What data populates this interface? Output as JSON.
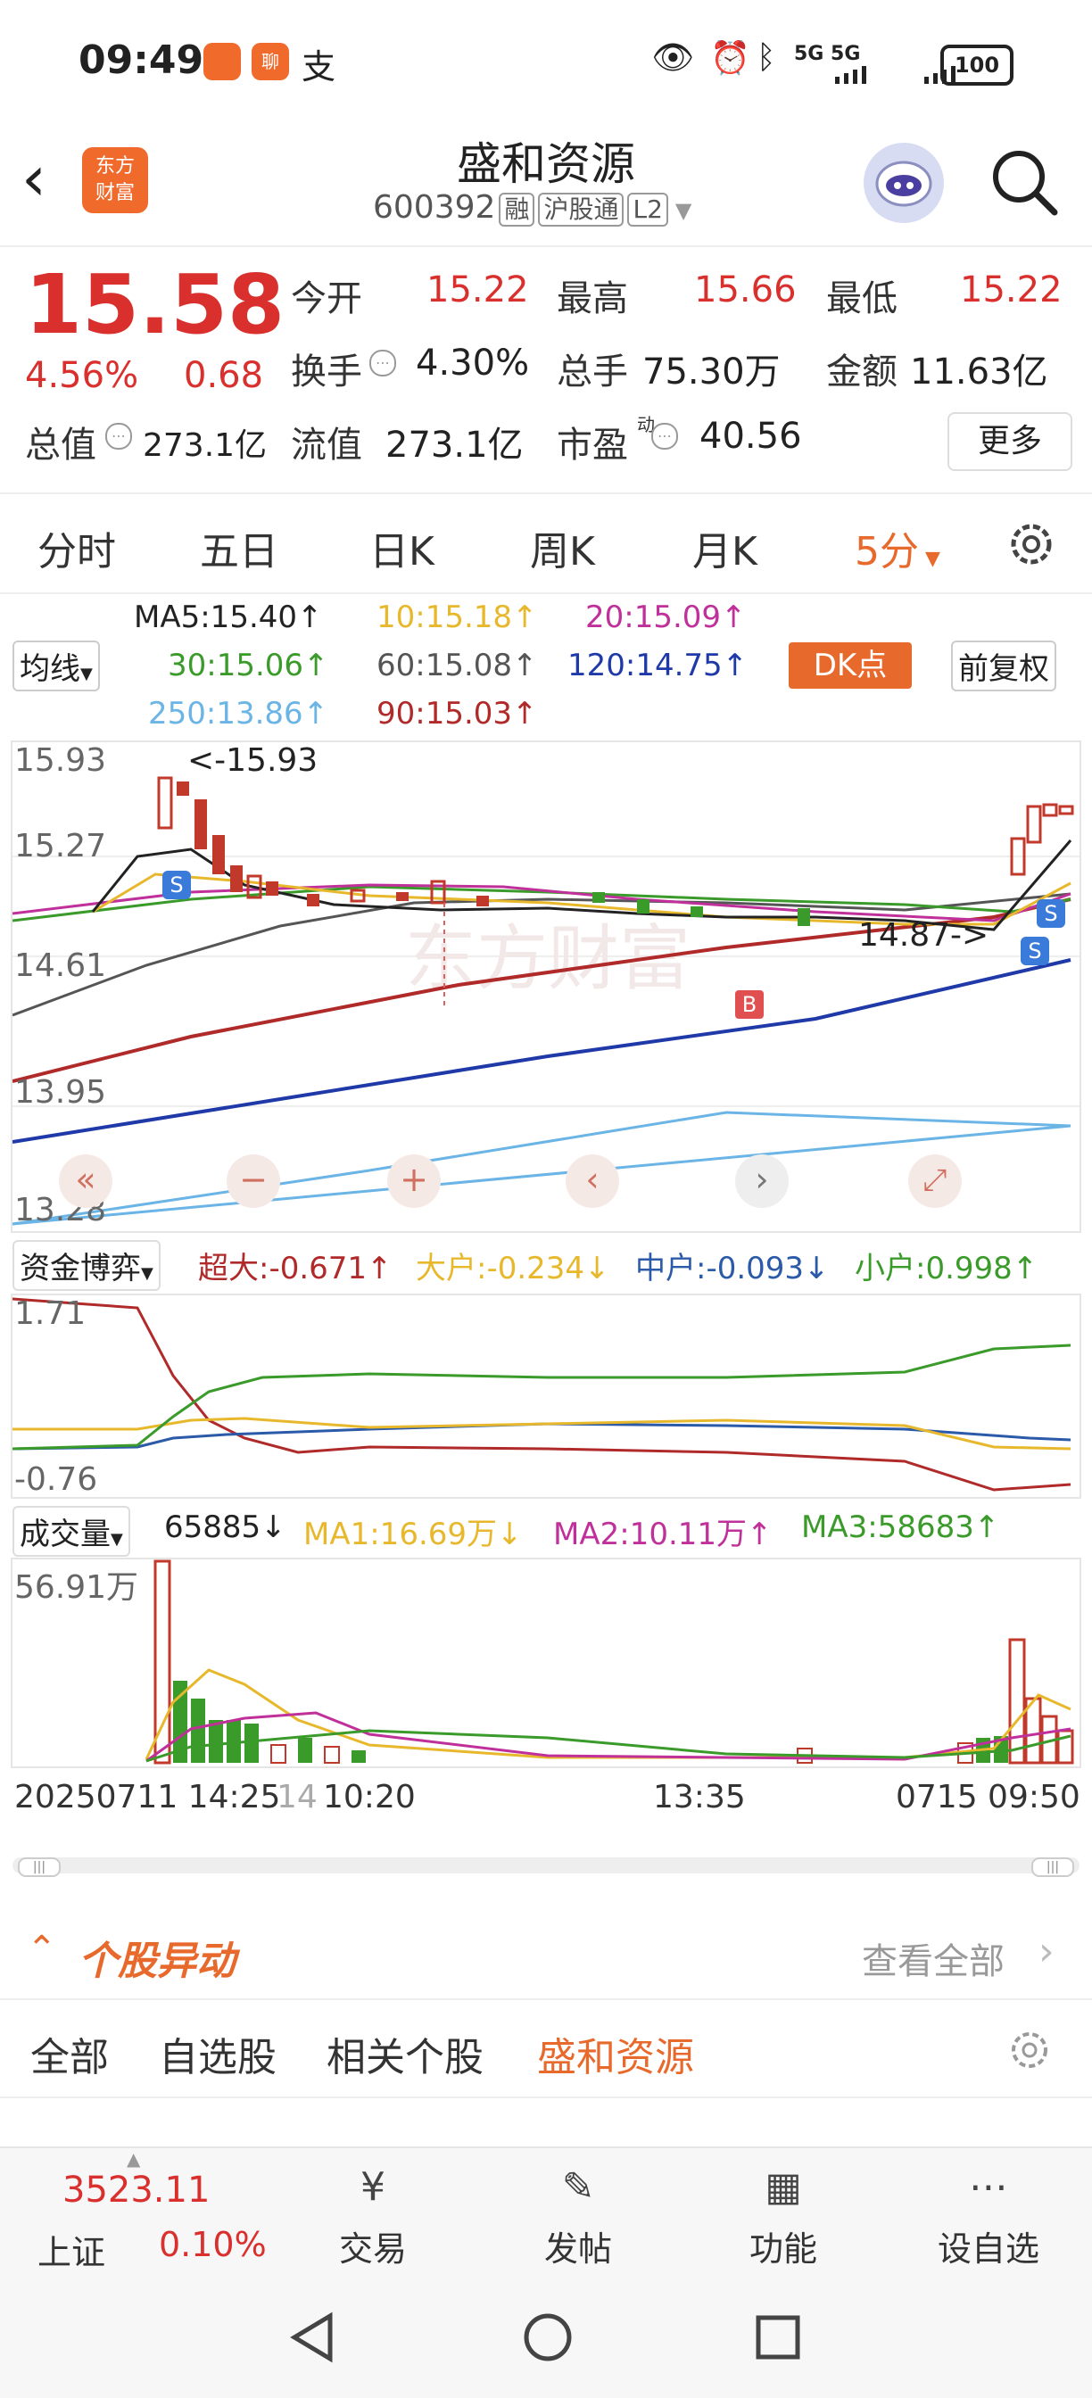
{
  "status_bar": {
    "time": "09:49",
    "app1": "",
    "app2": "聊",
    "app3": "支",
    "indicators": "5G 5G",
    "battery": "100"
  },
  "header": {
    "logo_line1": "东方",
    "logo_line2": "财富",
    "stock_name": "盛和资源",
    "stock_code": "600392",
    "tags": [
      "融",
      "沪股通",
      "L2"
    ]
  },
  "quote": {
    "price": "15.58",
    "change_pct": "4.56%",
    "change_amt": "0.68",
    "open_label": "今开",
    "open": "15.22",
    "high_label": "最高",
    "high": "15.66",
    "low_label": "最低",
    "low": "15.22",
    "turnover_label": "换手",
    "turnover": "4.30%",
    "volume_label": "总手",
    "volume": "75.30万",
    "amount_label": "金额",
    "amount": "11.63亿",
    "mktcap_label": "总值",
    "mktcap": "273.1亿",
    "float_label": "流值",
    "float": "273.1亿",
    "pe_label": "市盈",
    "pe_sup": "动",
    "pe": "40.56",
    "more": "更多"
  },
  "tabs": [
    "分时",
    "五日",
    "日K",
    "周K",
    "月K",
    "5分"
  ],
  "ma": {
    "selector": "均线",
    "ma5": "MA5:15.40↑",
    "ma10": "10:15.18↑",
    "ma20": "20:15.09↑",
    "ma30": "30:15.06↑",
    "ma60": "60:15.08↑",
    "ma120": "120:14.75↑",
    "ma250": "250:13.86↑",
    "ma90": "90:15.03↑",
    "dk": "DK点",
    "fuquan": "前复权",
    "colors": {
      "ma5": "#222222",
      "ma10": "#e8b82c",
      "ma20": "#c0309a",
      "ma30": "#3a9a2a",
      "ma60": "#555555",
      "ma120": "#1f3aa8",
      "ma250": "#6ab4e6",
      "ma90": "#b02a2a"
    }
  },
  "kline": {
    "y_labels": [
      "15.93",
      "15.27",
      "14.61",
      "13.95",
      "13.28"
    ],
    "high_mark": "<-15.93",
    "low_mark": "14.87->",
    "watermark": "东方财富",
    "controls": [
      "«",
      "−",
      "+",
      "‹",
      "›",
      "⤢"
    ]
  },
  "fund": {
    "selector": "资金博弈",
    "super": "超大:-0.671↑",
    "big": "大户:-0.234↓",
    "mid": "中户:-0.093↓",
    "small": "小户:0.998↑",
    "y_top": "1.71",
    "y_bottom": "-0.76"
  },
  "volume": {
    "selector": "成交量",
    "value": "65885↓",
    "ma1": "MA1:16.69万↓",
    "ma2": "MA2:10.11万↑",
    "ma3": "MA3:58683↑",
    "y_top": "56.91万"
  },
  "x_axis": {
    "left": "20250711 14:25",
    "sep": "14",
    "t1": "10:20",
    "t2": "13:35",
    "right": "0715 09:50"
  },
  "section": {
    "title": "个股异动",
    "view_all": "查看全部",
    "tabs": [
      "全部",
      "自选股",
      "相关个股",
      "盛和资源"
    ]
  },
  "bottom_nav": {
    "index_value": "3523.11",
    "index_name": "上证",
    "index_pct": "0.10%",
    "items": [
      "交易",
      "发帖",
      "功能",
      "设自选"
    ]
  }
}
